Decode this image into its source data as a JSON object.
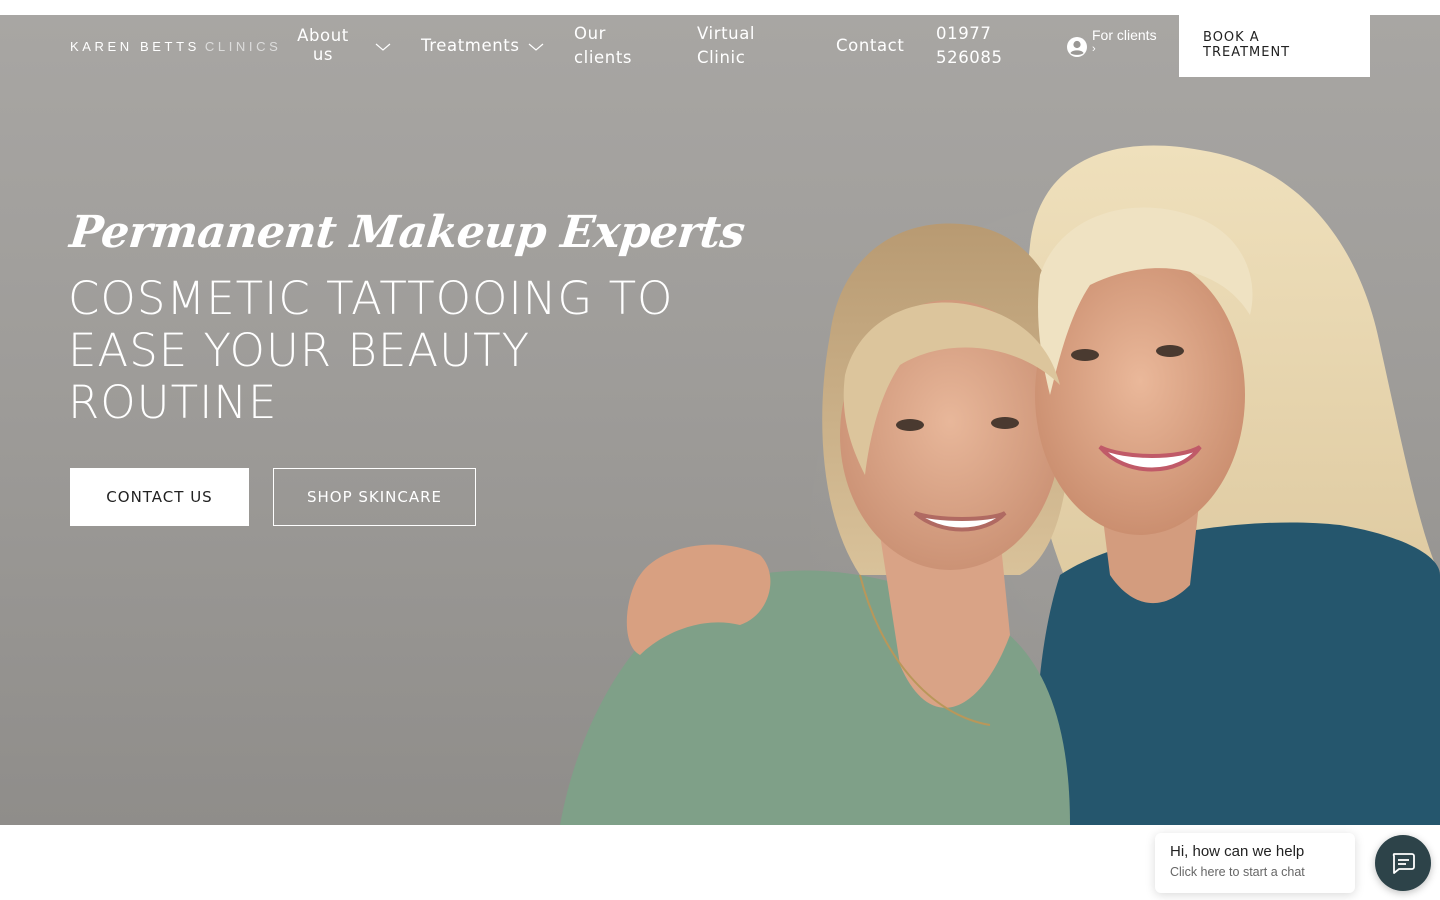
{
  "header": {
    "logo_primary": "KAREN BETTS",
    "logo_secondary": "CLINICS",
    "nav": {
      "about_line1": "About",
      "about_line2": "us",
      "treatments": "Treatments",
      "our_clients_line1": "Our",
      "our_clients_line2": "clients",
      "virtual_line1": "Virtual",
      "virtual_line2": "Clinic",
      "contact": "Contact",
      "phone_line1": "01977",
      "phone_line2": "526085"
    },
    "for_clients_label": "For clients",
    "for_clients_suffix": "›",
    "book_line1": "BOOK A",
    "book_line2": "TREATMENT"
  },
  "hero": {
    "script_title": "Permanent Makeup Experts",
    "title_line1": "COSMETIC TATTOOING TO",
    "title_line2": "EASE YOUR BEAUTY",
    "title_line3": "ROUTINE",
    "contact_button": "CONTACT US",
    "shop_button": "SHOP SKINCARE"
  },
  "chat": {
    "title": "Hi, how can we help",
    "subtitle": "Click here to start a chat"
  },
  "colors": {
    "hero_background": "#9e9c99",
    "chat_launcher": "#2d4349",
    "button_text": "#222222"
  },
  "icons": {
    "nav_dropdown": "chevron-down-icon",
    "account": "user-circle-icon",
    "chat": "chat-icon"
  }
}
